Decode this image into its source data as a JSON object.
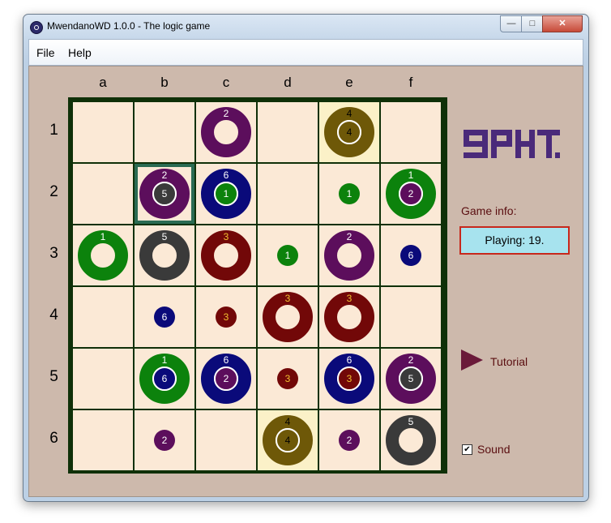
{
  "window": {
    "title": "MwendanoWD 1.0.0 - The logic game"
  },
  "menu": {
    "file": "File",
    "help": "Help"
  },
  "board": {
    "columns": [
      "a",
      "b",
      "c",
      "d",
      "e",
      "f"
    ],
    "rows": [
      "1",
      "2",
      "3",
      "4",
      "5",
      "6"
    ],
    "highlight_cells": [
      "e1",
      "d6"
    ],
    "selected_cell": "b2",
    "pieces": [
      {
        "cell": "c1",
        "outer": "purple",
        "outer_label": "2"
      },
      {
        "cell": "e1",
        "outer": "olive",
        "outer_label": "4",
        "inner": "olive",
        "inner_label": "4"
      },
      {
        "cell": "b2",
        "outer": "purple",
        "outer_label": "2",
        "inner": "charcoal",
        "inner_label": "5"
      },
      {
        "cell": "c2",
        "outer": "navy",
        "outer_label": "6",
        "inner": "green",
        "inner_label": "1"
      },
      {
        "cell": "e2",
        "inner": "green",
        "inner_label": "1"
      },
      {
        "cell": "f2",
        "outer": "green",
        "outer_label": "1",
        "inner": "purple",
        "inner_label": "2"
      },
      {
        "cell": "a3",
        "outer": "green",
        "outer_label": "1"
      },
      {
        "cell": "b3",
        "outer": "charcoal",
        "outer_label": "5"
      },
      {
        "cell": "c3",
        "outer": "maroon",
        "outer_label": "3"
      },
      {
        "cell": "d3",
        "inner": "green",
        "inner_label": "1"
      },
      {
        "cell": "e3",
        "outer": "purple",
        "outer_label": "2"
      },
      {
        "cell": "f3",
        "inner": "navy",
        "inner_label": "6"
      },
      {
        "cell": "b4",
        "inner": "navy",
        "inner_label": "6"
      },
      {
        "cell": "c4",
        "inner": "maroon",
        "inner_label": "3"
      },
      {
        "cell": "d4",
        "outer": "maroon",
        "outer_label": "3"
      },
      {
        "cell": "e4",
        "outer": "maroon",
        "outer_label": "3"
      },
      {
        "cell": "b5",
        "outer": "green",
        "outer_label": "1",
        "inner": "navy",
        "inner_label": "6"
      },
      {
        "cell": "c5",
        "outer": "navy",
        "outer_label": "6",
        "inner": "purple",
        "inner_label": "2"
      },
      {
        "cell": "d5",
        "inner": "maroon",
        "inner_label": "3"
      },
      {
        "cell": "e5",
        "outer": "navy",
        "outer_label": "6",
        "inner": "maroon",
        "inner_label": "3"
      },
      {
        "cell": "f5",
        "outer": "purple",
        "outer_label": "2",
        "inner": "charcoal",
        "inner_label": "5"
      },
      {
        "cell": "b6",
        "inner": "purple",
        "inner_label": "2"
      },
      {
        "cell": "d6",
        "outer": "olive",
        "outer_label": "4",
        "inner": "olive",
        "inner_label": "4"
      },
      {
        "cell": "e6",
        "inner": "purple",
        "inner_label": "2"
      },
      {
        "cell": "f6",
        "outer": "charcoal",
        "outer_label": "5"
      }
    ]
  },
  "colors": {
    "purple": "#5c0e5c",
    "navy": "#0a0a7a",
    "green": "#0c820c",
    "maroon": "#720808",
    "olive": "#6e5808",
    "charcoal": "#3a3a3a",
    "label_white": "#ffffff",
    "label_gold": "#f0c030",
    "label_dark": "#000000"
  },
  "sidebar": {
    "logo": "logo-mark",
    "game_info_label": "Game info:",
    "status": "Playing: 19.",
    "tutorial_label": "Tutorial",
    "sound_label": "Sound",
    "sound_checked": "✔"
  }
}
